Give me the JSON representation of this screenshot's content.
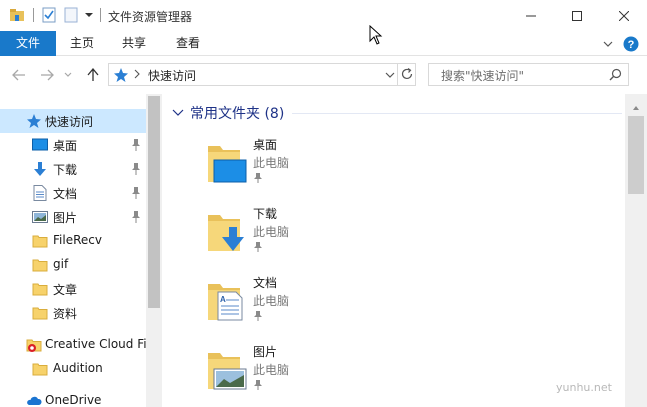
{
  "window": {
    "title": "文件资源管理器",
    "accent_color": "#1979ca"
  },
  "titlebar": {
    "quick_access_icons": [
      "folder-home-icon",
      "properties-check-icon",
      "new-folder-icon",
      "customize-dropdown-icon"
    ],
    "minimize_icon": "minimize-icon",
    "maximize_icon": "maximize-icon",
    "close_icon": "close-icon"
  },
  "ribbon": {
    "tabs": [
      {
        "label": "文件"
      },
      {
        "label": "主页"
      },
      {
        "label": "共享"
      },
      {
        "label": "查看"
      }
    ],
    "expand_icon": "chevron-down-icon",
    "help_icon": "help-icon"
  },
  "address": {
    "path": "快速访问",
    "search_placeholder": "搜索\"快速访问\""
  },
  "nav": {
    "items": [
      {
        "label": "快速访问",
        "icon": "star-icon",
        "selected": true
      },
      {
        "label": "桌面",
        "icon": "desktop-icon",
        "pinned": true
      },
      {
        "label": "下载",
        "icon": "download-icon",
        "pinned": true
      },
      {
        "label": "文档",
        "icon": "document-icon",
        "pinned": true
      },
      {
        "label": "图片",
        "icon": "picture-icon",
        "pinned": true
      },
      {
        "label": "FileRecv",
        "icon": "folder-icon"
      },
      {
        "label": "gif",
        "icon": "folder-icon"
      },
      {
        "label": "文章",
        "icon": "folder-icon"
      },
      {
        "label": "资料",
        "icon": "folder-icon"
      },
      {
        "label": "Creative Cloud Fil",
        "icon": "creative-cloud-icon"
      },
      {
        "label": "Audition",
        "icon": "folder-icon"
      },
      {
        "label": "OneDrive",
        "icon": "cloud-icon"
      }
    ]
  },
  "content": {
    "group_title": "常用文件夹 (8)",
    "folders": [
      {
        "name": "桌面",
        "location": "此电脑"
      },
      {
        "name": "下载",
        "location": "此电脑"
      },
      {
        "name": "文档",
        "location": "此电脑"
      },
      {
        "name": "图片",
        "location": "此电脑"
      }
    ]
  },
  "watermark": "yunhu.net"
}
